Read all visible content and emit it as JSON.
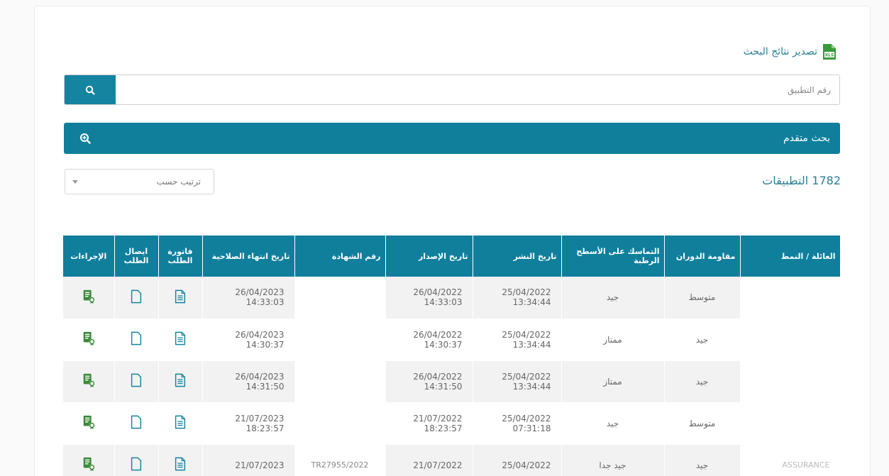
{
  "export": {
    "label": "تصدير نتائج البحث",
    "icon": "xls-file-icon"
  },
  "search": {
    "placeholder": "رقم التطبيق",
    "value": "",
    "button_icon": "search-icon"
  },
  "advanced": {
    "label": "بحث متقدم",
    "icon": "zoom-in-icon"
  },
  "sort": {
    "label": "ترتيب حسب"
  },
  "results": {
    "count_text": "1782 التطبيقات"
  },
  "colors": {
    "primary": "#0f7f9c",
    "link": "#2a7f98",
    "icon_green": "#3a8a3a",
    "icon_teal": "#1484a0"
  },
  "table": {
    "headers": {
      "family": "العائلة / النمط",
      "rolling": "مقاومة الدوران",
      "wet_grip": "التماسك على الأسطح الرطبة",
      "publish_date": "تاريخ النشر",
      "issue_date": "تاريخ الإصدار",
      "certificate": "رقم الشهادة",
      "expiry": "تاريخ انتهاء الصلاحية",
      "invoice": "فاتورة الطلب",
      "receipt": "ايصال الطلب",
      "actions": "الإجراءات"
    },
    "rows": [
      {
        "family": "",
        "rolling": "متوسط",
        "wet_grip": "جيد",
        "publish_date": "25/04/2022",
        "publish_time": "13:34:44",
        "issue_date": "26/04/2022",
        "issue_time": "14:33:03",
        "certificate": "",
        "expiry_date": "26/04/2023",
        "expiry_time": "14:33:03"
      },
      {
        "family": "",
        "rolling": "جيد",
        "wet_grip": "ممتاز",
        "publish_date": "25/04/2022",
        "publish_time": "13:34:44",
        "issue_date": "26/04/2022",
        "issue_time": "14:30:37",
        "certificate": "",
        "expiry_date": "26/04/2023",
        "expiry_time": "14:30:37"
      },
      {
        "family": "",
        "rolling": "جيد",
        "wet_grip": "ممتاز",
        "publish_date": "25/04/2022",
        "publish_time": "13:34:44",
        "issue_date": "26/04/2022",
        "issue_time": "14:31:50",
        "certificate": "",
        "expiry_date": "26/04/2023",
        "expiry_time": "14:31:50"
      },
      {
        "family": "",
        "rolling": "متوسط",
        "wet_grip": "جيد",
        "publish_date": "25/04/2022",
        "publish_time": "07:31:18",
        "issue_date": "21/07/2022",
        "issue_time": "18:23:57",
        "certificate": "",
        "expiry_date": "21/07/2023",
        "expiry_time": "18:23:57"
      },
      {
        "family": "ASSURANCE",
        "rolling": "جيد",
        "wet_grip": "جيد جدا",
        "publish_date": "25/04/2022",
        "publish_time": "",
        "issue_date": "21/07/2022",
        "issue_time": "",
        "certificate": "TR27955/2022",
        "expiry_date": "21/07/2023",
        "expiry_time": ""
      }
    ]
  }
}
